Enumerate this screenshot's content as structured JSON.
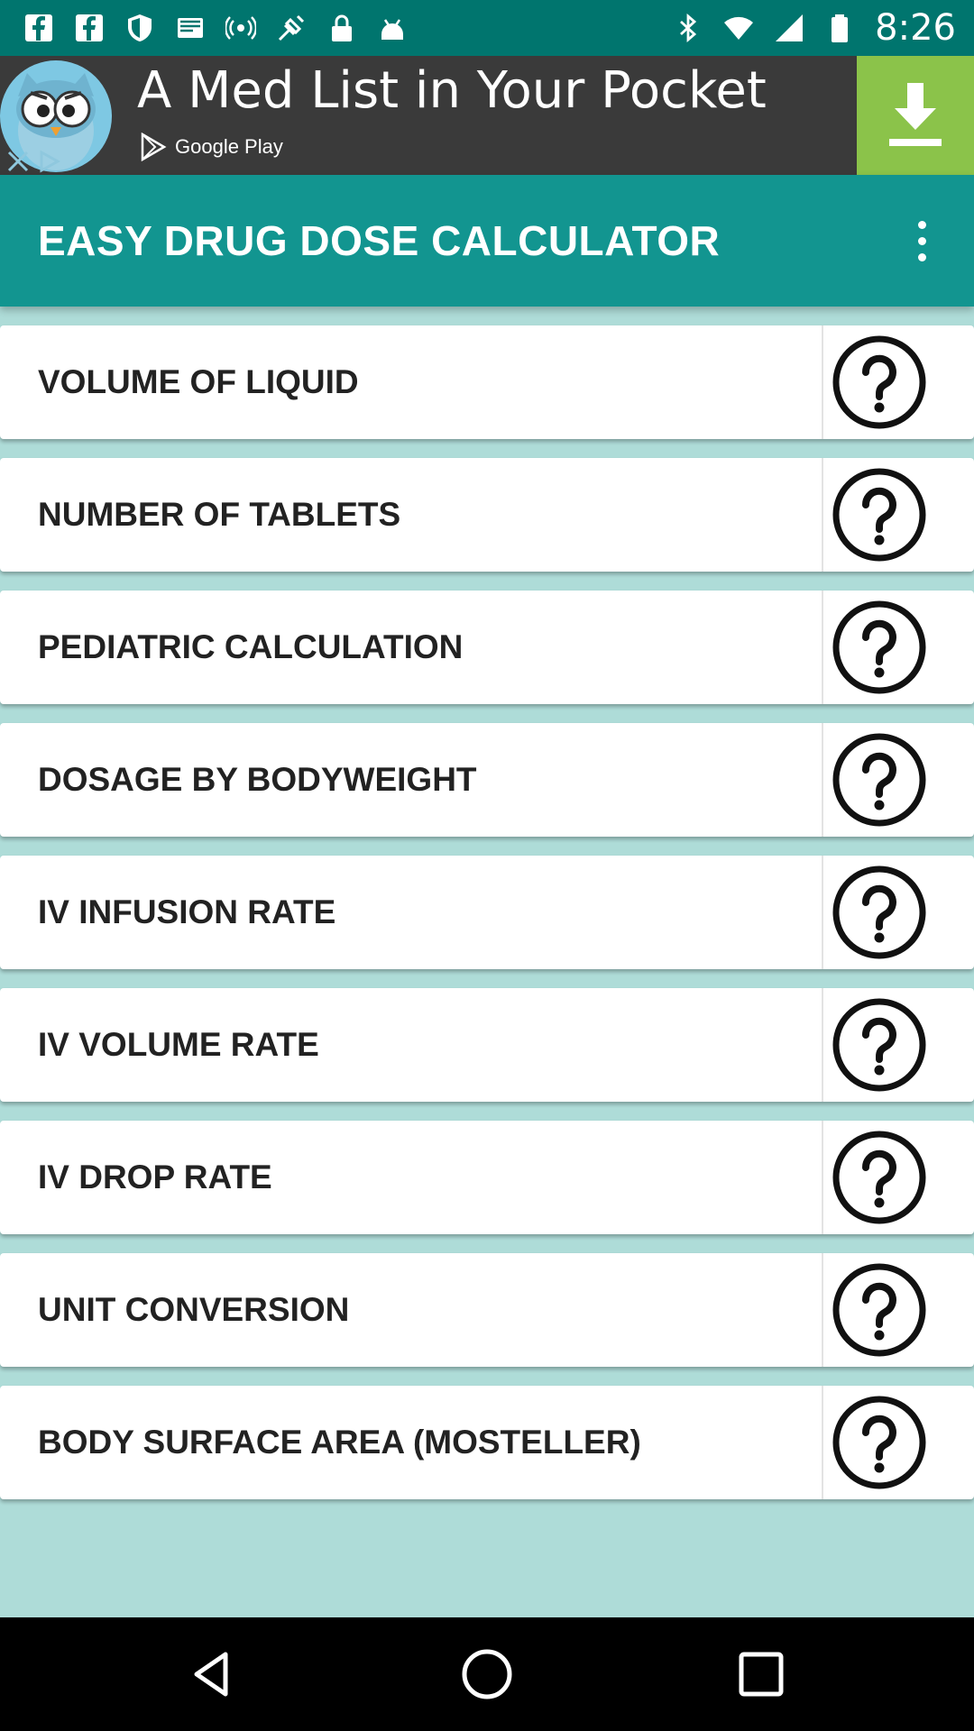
{
  "status_bar": {
    "time": "8:26",
    "left_icons": [
      "facebook-icon",
      "facebook-icon",
      "shield-icon",
      "email-icon",
      "signal-icon",
      "fake-gps-icon",
      "lock-icon",
      "android-icon"
    ],
    "right_icons": [
      "bluetooth-icon",
      "wifi-icon",
      "cell-signal-icon",
      "battery-icon"
    ]
  },
  "ad": {
    "headline": "A Med List in Your Pocket",
    "store_label": "Google Play",
    "download_icon": "download-icon",
    "accent_color": "#8bc34a"
  },
  "app_bar": {
    "title": "EASY DRUG DOSE CALCULATOR",
    "menu_icon": "more-vert-icon",
    "color": "#129590"
  },
  "menu": {
    "items": [
      {
        "label": "VOLUME OF LIQUID",
        "help_icon": "help-icon"
      },
      {
        "label": "NUMBER OF TABLETS",
        "help_icon": "help-icon"
      },
      {
        "label": "PEDIATRIC CALCULATION",
        "help_icon": "help-icon"
      },
      {
        "label": "DOSAGE BY BODYWEIGHT",
        "help_icon": "help-icon"
      },
      {
        "label": "IV INFUSION RATE",
        "help_icon": "help-icon"
      },
      {
        "label": "IV VOLUME RATE",
        "help_icon": "help-icon"
      },
      {
        "label": "IV DROP RATE",
        "help_icon": "help-icon"
      },
      {
        "label": "UNIT CONVERSION",
        "help_icon": "help-icon"
      },
      {
        "label": "BODY SURFACE AREA (MOSTELLER)",
        "help_icon": "help-icon"
      }
    ]
  },
  "nav_bar": {
    "buttons": [
      "back-icon",
      "home-icon",
      "recents-icon"
    ]
  },
  "colors": {
    "status_bar": "#00756e",
    "background": "#aedcd8"
  }
}
